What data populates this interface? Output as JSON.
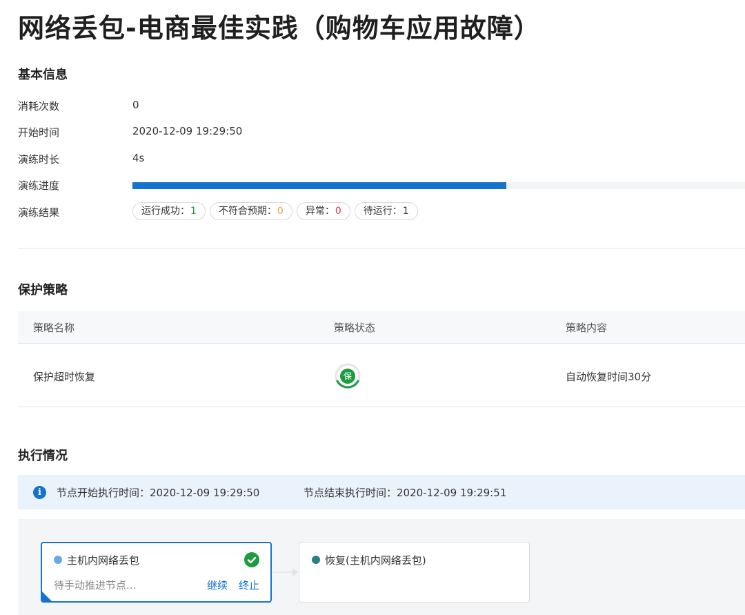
{
  "page": {
    "title": "网络丢包-电商最佳实践（购物车应用故障）"
  },
  "basic_info": {
    "title": "基本信息",
    "rows": [
      {
        "label": "消耗次数",
        "value": "0"
      },
      {
        "label": "开始时间",
        "value": "2020-12-09 19:29:50"
      },
      {
        "label": "演练时长",
        "value": "4s"
      },
      {
        "label": "演练进度",
        "value": ""
      },
      {
        "label": "演练结果",
        "value": ""
      }
    ],
    "progress_fraction": 0.61,
    "progress_color": "#1473cc",
    "results": [
      {
        "label": "运行成功：",
        "count": "1",
        "color": "#1e9a3f"
      },
      {
        "label": "不符合预期：",
        "count": "0",
        "color": "#e8a23a"
      },
      {
        "label": "异常：",
        "count": "0",
        "color": "#d9363e"
      },
      {
        "label": "待运行：",
        "count": "1",
        "color": "#333333"
      }
    ]
  },
  "protection": {
    "title": "保护策略",
    "columns": [
      "策略名称",
      "策略状态",
      "策略内容"
    ],
    "rows": [
      {
        "name": "保护超时恢复",
        "status_glyph": "保",
        "status_icon": "shield-icon",
        "status_color": "#1e9a3f",
        "content": "自动恢复时间30分"
      }
    ]
  },
  "execution": {
    "title": "执行情况",
    "info": {
      "start": "节点开始执行时间：2020-12-09 19:29:50",
      "end": "节点结束执行时间：2020-12-09 19:29:51"
    },
    "nodes": [
      {
        "title": "主机内网络丢包",
        "dot_color": "#6aa8e8",
        "status": "待手动推进节点...",
        "actions": [
          "继续",
          "终止"
        ],
        "done_icon": "check-circle-icon"
      },
      {
        "title": "恢复(主机内网络丢包)",
        "dot_color": "#2a7f86"
      }
    ]
  }
}
